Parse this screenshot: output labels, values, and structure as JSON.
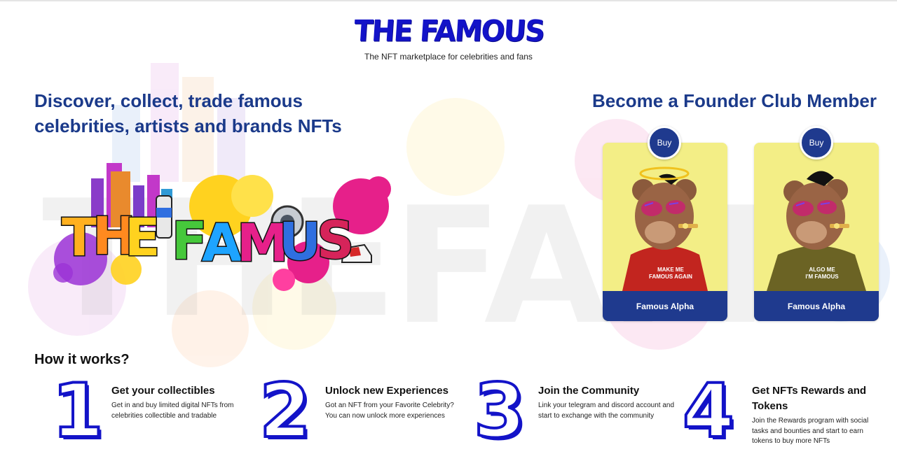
{
  "header": {
    "logo_text": "THE FAMOUS",
    "tagline": "The NFT marketplace for celebrities and fans"
  },
  "hero": {
    "title": "Discover, collect, trade famous celebrities, artists and brands NFTs",
    "art_text": "THE FAMOUS"
  },
  "founder": {
    "title": "Become a Founder Club Member",
    "cards": [
      {
        "buy_label": "Buy",
        "name": "Famous Alpha",
        "shirt_text_1": "MAKE ME",
        "shirt_text_2": "FAMOUS AGAIN"
      },
      {
        "buy_label": "Buy",
        "name": "Famous Alpha",
        "shirt_text_1": "ALGO ME",
        "shirt_text_2": "I'M FAMOUS"
      }
    ]
  },
  "how": {
    "title": "How it works?",
    "steps": [
      {
        "number": "1",
        "title": "Get your collectibles",
        "desc": "Get in and buy limited digital NFTs from celebrities collectible and tradable"
      },
      {
        "number": "2",
        "title": "Unlock new Experiences",
        "desc": "Got an NFT from your Favorite Celebrity? You can now unlock more experiences"
      },
      {
        "number": "3",
        "title": "Join the Community",
        "desc": "Link your telegram and discord account and start to exchange with the community"
      },
      {
        "number": "4",
        "title": "Get NFTs Rewards and Tokens",
        "desc": "Join the Rewards program with social tasks and bounties and start to earn tokens to buy more NFTs"
      }
    ]
  },
  "colors": {
    "brand_blue": "#1313c8",
    "navy": "#1f3a8e",
    "heading_blue": "#1b3a8a",
    "card_yellow": "#f3ee86"
  }
}
